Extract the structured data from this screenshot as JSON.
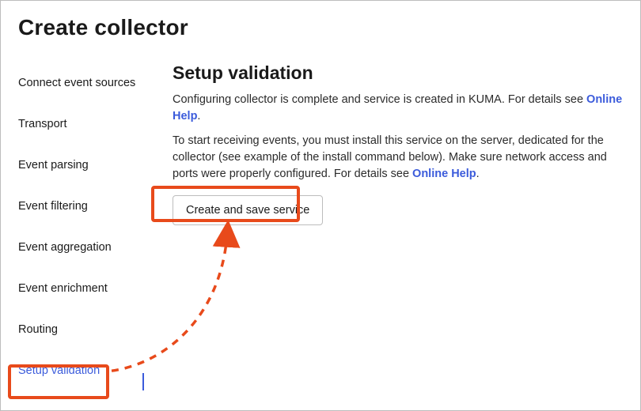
{
  "page": {
    "title": "Create collector"
  },
  "sidebar": {
    "items": [
      {
        "label": "Connect event sources"
      },
      {
        "label": "Transport"
      },
      {
        "label": "Event parsing"
      },
      {
        "label": "Event filtering"
      },
      {
        "label": "Event aggregation"
      },
      {
        "label": "Event enrichment"
      },
      {
        "label": "Routing"
      },
      {
        "label": "Setup validation"
      }
    ],
    "active_index": 7
  },
  "main": {
    "heading": "Setup validation",
    "para1_pre": "Configuring collector is complete and service is created in KUMA. For details see ",
    "para1_link": "Online Help",
    "para1_post": ".",
    "para2_pre": "To start receiving events, you must install this service on the server, dedicated for the collector (see example of the install command below). Make sure network access and ports were properly configured. For details see ",
    "para2_link": "Online Help",
    "para2_post": ".",
    "button_label": "Create and save service"
  },
  "annotation": {
    "color": "#e84a1b",
    "link_color": "#3b5bdb"
  }
}
